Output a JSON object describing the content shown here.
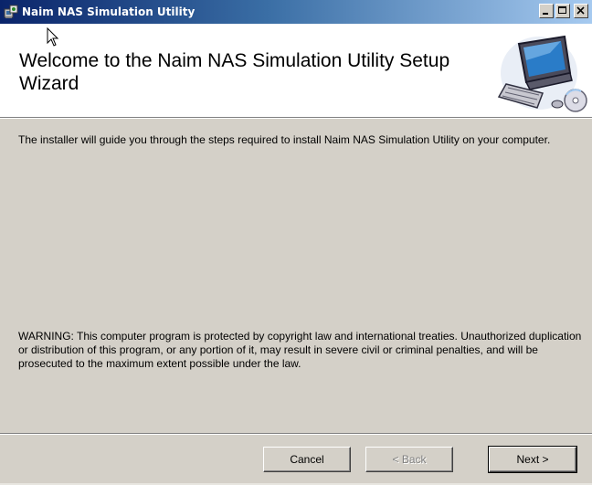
{
  "window": {
    "title": "Naim NAS Simulation Utility",
    "app_icon": "installer-icon",
    "controls": [
      "minimize-icon",
      "maximize-icon",
      "close-icon"
    ]
  },
  "banner": {
    "title": "Welcome to the Naim NAS Simulation Utility Setup Wizard",
    "graphic": "computer-disc-icon"
  },
  "body": {
    "intro": "The installer will guide you through the steps required to install Naim NAS Simulation Utility on your computer.",
    "warning": "WARNING: This computer program is protected by copyright law and international treaties. Unauthorized duplication or distribution of this program, or any portion of it, may result in severe civil or criminal penalties, and will be prosecuted to the maximum extent possible under the law."
  },
  "buttons": {
    "cancel": "Cancel",
    "back": "< Back",
    "next": "Next >"
  },
  "colors": {
    "titlebar_start": "#0a246a",
    "titlebar_end": "#a6caf0",
    "face": "#d4d0c8",
    "banner_bg": "#ffffff",
    "disabled_text": "#808080"
  }
}
